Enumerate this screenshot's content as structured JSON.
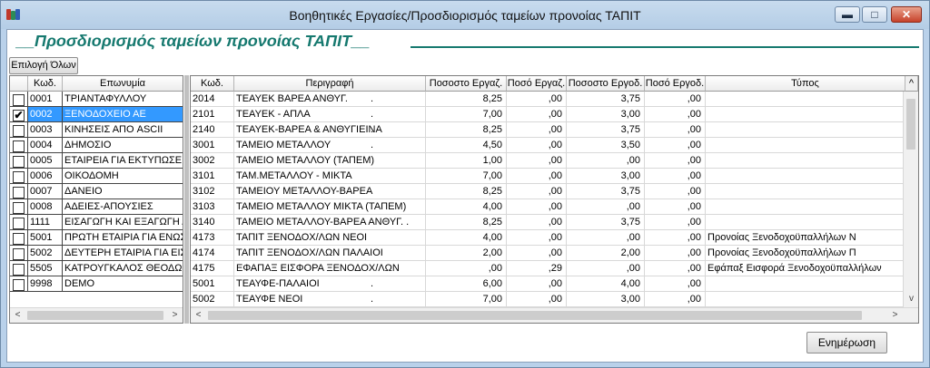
{
  "window": {
    "title": "Βοηθητικές Εργασίες/Προσδιορισμός ταμείων προνοίας ΤΑΠΙΤ",
    "min_glyph": "▬",
    "max_glyph": "□",
    "close_glyph": "✕"
  },
  "heading": "__Προσδιορισμός ταμείων προνοίας ΤΑΠΙΤ__",
  "buttons": {
    "select_all": "Επιλογή Όλων",
    "update": "Ενημέρωση"
  },
  "companies": {
    "columns": [
      "",
      "Κωδ.",
      "Επωνυμία"
    ],
    "rows": [
      {
        "code": "0001",
        "name": "ΤΡΙΑΝΤΑΦΥΛΛΟΥ",
        "checked": ""
      },
      {
        "code": "0002",
        "name": "ΞΕΝΟΔΟΧΕΙΟ ΑΕ",
        "checked": "✔"
      },
      {
        "code": "0003",
        "name": "ΚΙΝΗΣΕΙΣ ΑΠΟ ASCII",
        "checked": ""
      },
      {
        "code": "0004",
        "name": "ΔΗΜΟΣΙΟ",
        "checked": ""
      },
      {
        "code": "0005",
        "name": "ΕΤΑΙΡΕΙΑ ΓΙΑ ΕΚΤΥΠΩΣΕΙΣ Δ",
        "checked": ""
      },
      {
        "code": "0006",
        "name": "ΟΙΚΟΔΟΜΗ",
        "checked": ""
      },
      {
        "code": "0007",
        "name": "ΔΑΝΕΙΟ",
        "checked": ""
      },
      {
        "code": "0008",
        "name": "ΑΔΕΙΕΣ-ΑΠΟΥΣΙΕΣ",
        "checked": ""
      },
      {
        "code": "1111",
        "name": "ΕΙΣΑΓΩΓΗ ΚΑΙ ΕΞΑΓΩΓΗ ΔΙ",
        "checked": ""
      },
      {
        "code": "5001",
        "name": "ΠΡΩΤΗ ΕΤΑΙΡΙΑ ΓΙΑ ΕΝΩΣΗ",
        "checked": ""
      },
      {
        "code": "5002",
        "name": "ΔΕΥΤΕΡΗ ΕΤΑΙΡΙΑ ΓΙΑ ΕΙΣΑΓ",
        "checked": ""
      },
      {
        "code": "5505",
        "name": "ΚΑΤΡΟΥΓΚΑΛΟΣ ΘΕΟΔΩΡΟ",
        "checked": ""
      },
      {
        "code": "9998",
        "name": "DEMO",
        "checked": ""
      }
    ],
    "selected_index": 1
  },
  "funds": {
    "columns": [
      "Κωδ.",
      "Περιγραφή",
      "Ποσοστο Εργαζ.",
      "Ποσό Εργαζ.",
      "Ποσοστο Εργοδ.",
      "Ποσό Εργοδ.",
      "Τύπος"
    ],
    "rows": [
      {
        "code": "2014",
        "desc": "ΤΕΑΥΕΚ ΒΑΡΕΑ ΑΝΘΥΓ.",
        "mark": ".",
        "pct_emp": "8,25",
        "amt_emp": ",00",
        "pct_er": "3,75",
        "amt_er": ",00",
        "type": ""
      },
      {
        "code": "2101",
        "desc": "ΤΕΑΥΕΚ - ΑΠΛΑ",
        "mark": ".",
        "pct_emp": "7,00",
        "amt_emp": ",00",
        "pct_er": "3,00",
        "amt_er": ",00",
        "type": ""
      },
      {
        "code": "2140",
        "desc": "ΤΕΑΥΕΚ-ΒΑΡΕΑ & ΑΝΘΥΓΙΕΙΝΑ",
        "mark": ".",
        "pct_emp": "8,25",
        "amt_emp": ",00",
        "pct_er": "3,75",
        "amt_er": ",00",
        "type": ""
      },
      {
        "code": "3001",
        "desc": "ΤΑΜΕΙΟ ΜΕΤΑΛΛΟΥ",
        "mark": ".",
        "pct_emp": "4,50",
        "amt_emp": ",00",
        "pct_er": "3,50",
        "amt_er": ",00",
        "type": ""
      },
      {
        "code": "3002",
        "desc": "ΤΑΜΕΙΟ ΜΕΤΑΛΛΟΥ (ΤΑΠΕΜ)",
        "mark": "",
        "pct_emp": "1,00",
        "amt_emp": ",00",
        "pct_er": ",00",
        "amt_er": ",00",
        "type": ""
      },
      {
        "code": "3101",
        "desc": "ΤΑΜ.ΜΕΤΑΛΛΟΥ - ΜΙΚΤΑ",
        "mark": "",
        "pct_emp": "7,00",
        "amt_emp": ",00",
        "pct_er": "3,00",
        "amt_er": ",00",
        "type": ""
      },
      {
        "code": "3102",
        "desc": "ΤΑΜΕΙΟΥ ΜΕΤΑΛΛΟΥ-ΒΑΡΕΑ",
        "mark": "",
        "pct_emp": "8,25",
        "amt_emp": ",00",
        "pct_er": "3,75",
        "amt_er": ",00",
        "type": ""
      },
      {
        "code": "3103",
        "desc": "ΤΑΜΕΙΟ ΜΕΤΑΛΛΟΥ ΜΙΚΤΑ (ΤΑΠΕΜ)",
        "mark": "",
        "pct_emp": "4,00",
        "amt_emp": ",00",
        "pct_er": ",00",
        "amt_er": ",00",
        "type": ""
      },
      {
        "code": "3140",
        "desc": "ΤΑΜΕΙΟ ΜΕΤΑΛΛΟΥ-ΒΑΡΕΑ ΑΝΘΥΓ. .",
        "mark": "",
        "pct_emp": "8,25",
        "amt_emp": ",00",
        "pct_er": "3,75",
        "amt_er": ",00",
        "type": ""
      },
      {
        "code": "4173",
        "desc": "ΤΑΠΙΤ ΞΕΝΟΔΟΧ/ΛΩΝ ΝΕΟΙ",
        "mark": "",
        "pct_emp": "4,00",
        "amt_emp": ",00",
        "pct_er": ",00",
        "amt_er": ",00",
        "type": "Προνοίας Ξενοδοχοϋπαλλήλων Ν"
      },
      {
        "code": "4174",
        "desc": "ΤΑΠΙΤ ΞΕΝΟΔΟΧ/ΛΩΝ ΠΑΛΑΙΟΙ",
        "mark": "",
        "pct_emp": "2,00",
        "amt_emp": ",00",
        "pct_er": "2,00",
        "amt_er": ",00",
        "type": "Προνοίας Ξενοδοχοϋπαλλήλων Π"
      },
      {
        "code": "4175",
        "desc": "ΕΦΑΠΑΞ ΕΙΣΦΟΡΑ ΞΕΝΟΔΟΧ/ΛΩΝ",
        "mark": "",
        "pct_emp": ",00",
        "amt_emp": ",29",
        "pct_er": ",00",
        "amt_er": ",00",
        "type": "Εφάπαξ Εισφορά Ξενοδοχοϋπαλλήλων"
      },
      {
        "code": "5001",
        "desc": "ΤΕΑΥΦΕ-ΠΑΛΑΙΟΙ",
        "mark": ".",
        "pct_emp": "6,00",
        "amt_emp": ",00",
        "pct_er": "4,00",
        "amt_er": ",00",
        "type": ""
      },
      {
        "code": "5002",
        "desc": "ΤΕΑΥΦΕ ΝΕΟΙ",
        "mark": ".",
        "pct_emp": "7,00",
        "amt_emp": ",00",
        "pct_er": "3,00",
        "amt_er": ",00",
        "type": ""
      }
    ]
  },
  "scroll": {
    "left_arrow": "<",
    "right_arrow": ">",
    "up_arrow": "^",
    "down_arrow": "v"
  },
  "colors": {
    "heading": "#16796f",
    "selection": "#3399ff",
    "titlebar": "#b9d1ea"
  }
}
